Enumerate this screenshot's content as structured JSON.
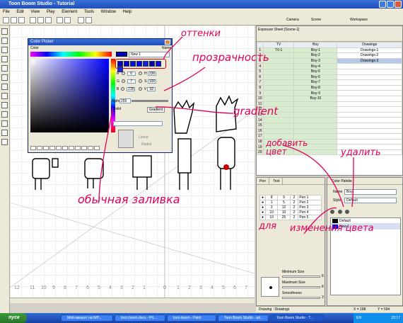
{
  "window": {
    "title": "Toon Boom Studio - Tutorial"
  },
  "menu": [
    "File",
    "Edit",
    "View",
    "Play",
    "Element",
    "Tools",
    "Window",
    "Help"
  ],
  "toolbar": {
    "camera": "Camera",
    "scene": "Scene",
    "workspace": "Workspace"
  },
  "color_picker": {
    "title": "Color Picker",
    "color_label": "Color",
    "name_label": "Name",
    "name_value": "New 1",
    "fields": [
      {
        "label": "R",
        "value": "0"
      },
      {
        "label": "G",
        "value": "7"
      },
      {
        "label": "B",
        "value": "235"
      }
    ],
    "hsv_fields": [
      {
        "label": "H",
        "value": "236"
      },
      {
        "label": "S",
        "value": "100"
      },
      {
        "label": "V",
        "value": "92"
      }
    ],
    "alpha_label": "Alpha",
    "alpha_value": "255",
    "solid": "Solid",
    "gradient": "Gradient",
    "linear": "Linear",
    "radial": "Radial",
    "swatch_colors": [
      "#0000c8",
      "#0000d8",
      "#0010e0",
      "#0000ff",
      "#1020f0",
      "#0000b8",
      "#0808e8",
      "#2020ff"
    ]
  },
  "exposure_sheet": {
    "tab": "Exposure Sheet [Scene-1]",
    "columns": [
      "TV",
      "Boy",
      "Drawings"
    ],
    "rows": [
      {
        "num": "1",
        "tv": "TV-1",
        "boy": "Boy-1",
        "draw": "Drawings-1"
      },
      {
        "num": "2",
        "tv": "",
        "boy": "Boy-2",
        "draw": "Drawings-2"
      },
      {
        "num": "3",
        "tv": "",
        "boy": "Boy-3",
        "draw": "Drawings-3"
      },
      {
        "num": "4",
        "tv": "",
        "boy": "Boy-4",
        "draw": ""
      },
      {
        "num": "5",
        "tv": "",
        "boy": "Boy-5",
        "draw": ""
      },
      {
        "num": "6",
        "tv": "",
        "boy": "Boy-6",
        "draw": ""
      },
      {
        "num": "7",
        "tv": "",
        "boy": "Boy-7",
        "draw": ""
      },
      {
        "num": "8",
        "tv": "",
        "boy": "Boy-8",
        "draw": ""
      },
      {
        "num": "9",
        "tv": "",
        "boy": "Boy-9",
        "draw": ""
      },
      {
        "num": "10",
        "tv": "",
        "boy": "Boy-10",
        "draw": ""
      },
      {
        "num": "11",
        "tv": "",
        "boy": "",
        "draw": ""
      },
      {
        "num": "12",
        "tv": "",
        "boy": "",
        "draw": ""
      },
      {
        "num": "13",
        "tv": "",
        "boy": "",
        "draw": ""
      },
      {
        "num": "14",
        "tv": "",
        "boy": "",
        "draw": ""
      },
      {
        "num": "15",
        "tv": "",
        "boy": "",
        "draw": ""
      },
      {
        "num": "16",
        "tv": "",
        "boy": "",
        "draw": ""
      },
      {
        "num": "17",
        "tv": "",
        "boy": "",
        "draw": ""
      },
      {
        "num": "18",
        "tv": "",
        "boy": "",
        "draw": ""
      },
      {
        "num": "19",
        "tv": "",
        "boy": "",
        "draw": ""
      },
      {
        "num": "20",
        "tv": "",
        "boy": "",
        "draw": ""
      }
    ]
  },
  "pen_panel": {
    "tabs": [
      "Pen",
      "Text"
    ],
    "rows": [
      {
        "a": "8",
        "b": "9",
        "c": "2",
        "name": "Pen 1"
      },
      {
        "a": "1",
        "b": "5",
        "c": "2",
        "name": "Pen 2"
      },
      {
        "a": "3",
        "b": "12",
        "c": "2",
        "name": "Pen 3"
      },
      {
        "a": "10",
        "b": "10",
        "c": "2",
        "name": "Pen 4"
      },
      {
        "a": "10",
        "b": "25",
        "c": "2",
        "name": "Pen 5"
      }
    ],
    "min_size": "Minimum Size",
    "min_val": "8",
    "max_size": "Maximum Size",
    "max_val": "8",
    "smoothness": "Smoothness",
    "smooth_val": "3"
  },
  "color_palette": {
    "tab": "Color Palette",
    "name_label": "Name",
    "name_value": "Boy",
    "style_label": "Style",
    "style_value": "Default",
    "items": [
      {
        "name": "Default",
        "color": "#000000"
      },
      {
        "name": "New 1",
        "color": "#0000e8"
      }
    ]
  },
  "status": {
    "drawing": "Drawing : Drawings",
    "x": "X = 188",
    "y": "Y = 594"
  },
  "taskbar": {
    "start": "пуск",
    "tasks": [
      "Мой аккаунт на WP...",
      "toon boom.docx - Pit...",
      "toon boom - Paint",
      "Toon Boom Studio - ad...",
      "Toon Boom Studio - T..."
    ],
    "lang": "EN",
    "time": "23:17"
  },
  "annotations": {
    "shades": "оттенки",
    "transparency": "прозрачность",
    "gradient": "gradient",
    "add_color": "добавить цвет",
    "delete": "удалить",
    "solid_fill": "обычная заливка",
    "for": "для",
    "change_color": "изменения цвета"
  }
}
